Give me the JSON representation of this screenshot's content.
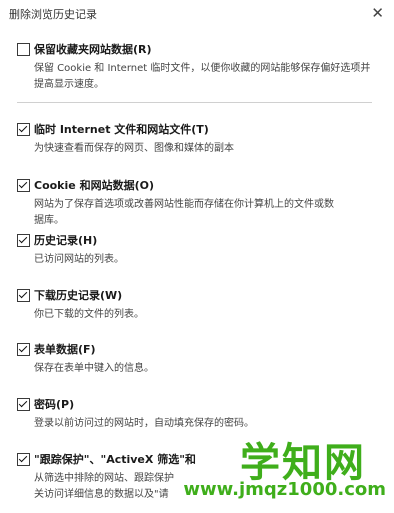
{
  "dialog": {
    "title": "删除浏览历史记录",
    "close_glyph": "✕"
  },
  "options": [
    {
      "label": "保留收藏夹网站数据(R)",
      "checked": false,
      "description": [
        "保留 Cookie 和 Internet 临时文件，以便你收藏的网站能够保存偏好选项并",
        "提高显示速度。"
      ]
    },
    {
      "label": "临时 Internet 文件和网站文件(T)",
      "checked": true,
      "description": [
        "为快速查看而保存的网页、图像和媒体的副本"
      ]
    },
    {
      "label": "Cookie 和网站数据(O)",
      "checked": true,
      "description": [
        "网站为了保存首选项或改善网站性能而存储在你计算机上的文件或数",
        "据库。"
      ]
    },
    {
      "label": "历史记录(H)",
      "checked": true,
      "description": [
        "已访问网站的列表。"
      ]
    },
    {
      "label": "下载历史记录(W)",
      "checked": true,
      "description": [
        "你已下载的文件的列表。"
      ]
    },
    {
      "label": "表单数据(F)",
      "checked": true,
      "description": [
        "保存在表单中键入的信息。"
      ]
    },
    {
      "label": "密码(P)",
      "checked": true,
      "description": [
        "登录以前访问过的网站时，自动填充保存的密码。"
      ]
    },
    {
      "label": "\"跟踪保护\"、\"ActiveX 筛选\"和",
      "checked": true,
      "description": [
        "从筛选中排除的网站、跟踪保护",
        "关访问详细信息的数据以及\"请"
      ]
    }
  ],
  "watermark": {
    "main": "学知网",
    "sub": "www.jmqz1000.com"
  }
}
